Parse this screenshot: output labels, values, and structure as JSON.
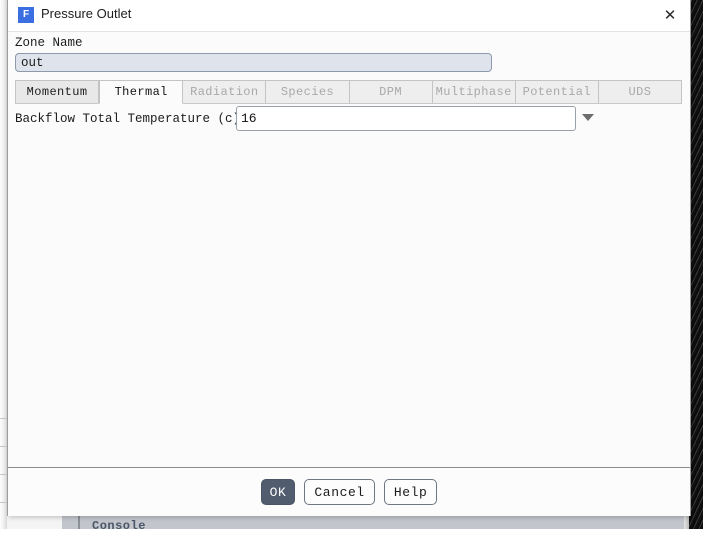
{
  "window": {
    "title": "Pressure Outlet",
    "icon": "fluent-app-icon",
    "icon_letter": "F",
    "close_label": "✕"
  },
  "zone": {
    "label": "Zone Name",
    "value": "out",
    "placeholder": ""
  },
  "tabs": [
    {
      "label": "Momentum",
      "state": "enabled"
    },
    {
      "label": "Thermal",
      "state": "active"
    },
    {
      "label": "Radiation",
      "state": "disabled"
    },
    {
      "label": "Species",
      "state": "disabled"
    },
    {
      "label": "DPM",
      "state": "disabled"
    },
    {
      "label": "Multiphase",
      "state": "disabled"
    },
    {
      "label": "Potential",
      "state": "disabled"
    },
    {
      "label": "UDS",
      "state": "disabled"
    }
  ],
  "thermal": {
    "temperature_label": "Backflow Total Temperature (c)",
    "temperature_value": "16",
    "temperature_placeholder": "",
    "dropdown_icon": "chevron-down-icon"
  },
  "footer": {
    "ok_label": "OK",
    "cancel_label": "Cancel",
    "help_label": "Help"
  },
  "background": {
    "console_label": "Console"
  },
  "colors": {
    "accent": "#3b6ee0",
    "primary_button": "#515c6e",
    "readonly_field": "#dfe4ec",
    "dialog_background": "#fbfbfb"
  }
}
